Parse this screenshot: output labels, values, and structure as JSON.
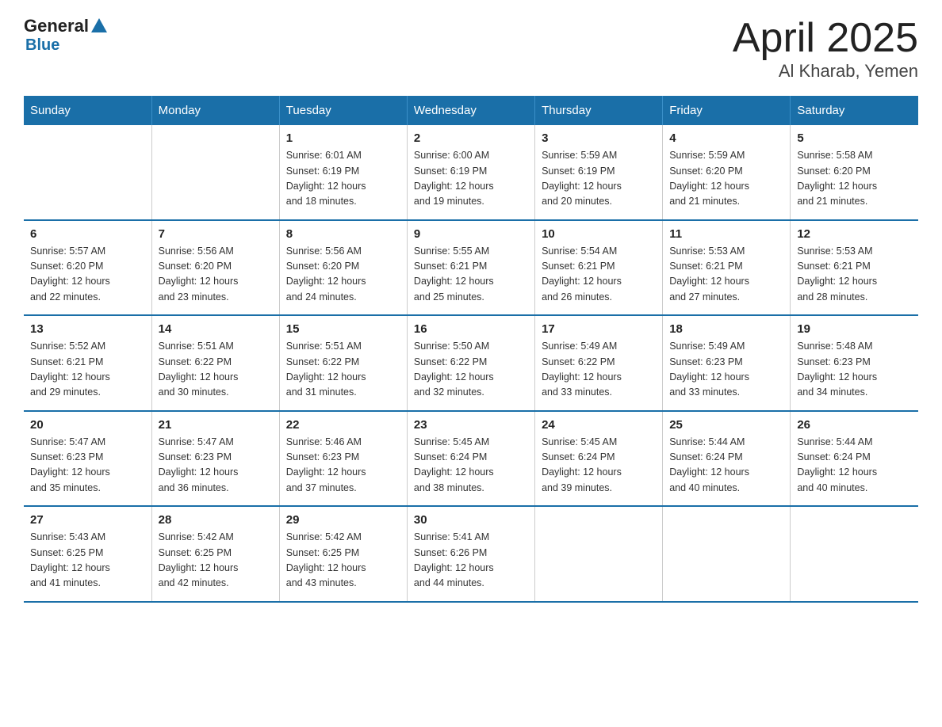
{
  "logo": {
    "general": "General",
    "blue": "Blue"
  },
  "title": "April 2025",
  "subtitle": "Al Kharab, Yemen",
  "days_header": [
    "Sunday",
    "Monday",
    "Tuesday",
    "Wednesday",
    "Thursday",
    "Friday",
    "Saturday"
  ],
  "weeks": [
    [
      {
        "day": "",
        "info": ""
      },
      {
        "day": "",
        "info": ""
      },
      {
        "day": "1",
        "info": "Sunrise: 6:01 AM\nSunset: 6:19 PM\nDaylight: 12 hours\nand 18 minutes."
      },
      {
        "day": "2",
        "info": "Sunrise: 6:00 AM\nSunset: 6:19 PM\nDaylight: 12 hours\nand 19 minutes."
      },
      {
        "day": "3",
        "info": "Sunrise: 5:59 AM\nSunset: 6:19 PM\nDaylight: 12 hours\nand 20 minutes."
      },
      {
        "day": "4",
        "info": "Sunrise: 5:59 AM\nSunset: 6:20 PM\nDaylight: 12 hours\nand 21 minutes."
      },
      {
        "day": "5",
        "info": "Sunrise: 5:58 AM\nSunset: 6:20 PM\nDaylight: 12 hours\nand 21 minutes."
      }
    ],
    [
      {
        "day": "6",
        "info": "Sunrise: 5:57 AM\nSunset: 6:20 PM\nDaylight: 12 hours\nand 22 minutes."
      },
      {
        "day": "7",
        "info": "Sunrise: 5:56 AM\nSunset: 6:20 PM\nDaylight: 12 hours\nand 23 minutes."
      },
      {
        "day": "8",
        "info": "Sunrise: 5:56 AM\nSunset: 6:20 PM\nDaylight: 12 hours\nand 24 minutes."
      },
      {
        "day": "9",
        "info": "Sunrise: 5:55 AM\nSunset: 6:21 PM\nDaylight: 12 hours\nand 25 minutes."
      },
      {
        "day": "10",
        "info": "Sunrise: 5:54 AM\nSunset: 6:21 PM\nDaylight: 12 hours\nand 26 minutes."
      },
      {
        "day": "11",
        "info": "Sunrise: 5:53 AM\nSunset: 6:21 PM\nDaylight: 12 hours\nand 27 minutes."
      },
      {
        "day": "12",
        "info": "Sunrise: 5:53 AM\nSunset: 6:21 PM\nDaylight: 12 hours\nand 28 minutes."
      }
    ],
    [
      {
        "day": "13",
        "info": "Sunrise: 5:52 AM\nSunset: 6:21 PM\nDaylight: 12 hours\nand 29 minutes."
      },
      {
        "day": "14",
        "info": "Sunrise: 5:51 AM\nSunset: 6:22 PM\nDaylight: 12 hours\nand 30 minutes."
      },
      {
        "day": "15",
        "info": "Sunrise: 5:51 AM\nSunset: 6:22 PM\nDaylight: 12 hours\nand 31 minutes."
      },
      {
        "day": "16",
        "info": "Sunrise: 5:50 AM\nSunset: 6:22 PM\nDaylight: 12 hours\nand 32 minutes."
      },
      {
        "day": "17",
        "info": "Sunrise: 5:49 AM\nSunset: 6:22 PM\nDaylight: 12 hours\nand 33 minutes."
      },
      {
        "day": "18",
        "info": "Sunrise: 5:49 AM\nSunset: 6:23 PM\nDaylight: 12 hours\nand 33 minutes."
      },
      {
        "day": "19",
        "info": "Sunrise: 5:48 AM\nSunset: 6:23 PM\nDaylight: 12 hours\nand 34 minutes."
      }
    ],
    [
      {
        "day": "20",
        "info": "Sunrise: 5:47 AM\nSunset: 6:23 PM\nDaylight: 12 hours\nand 35 minutes."
      },
      {
        "day": "21",
        "info": "Sunrise: 5:47 AM\nSunset: 6:23 PM\nDaylight: 12 hours\nand 36 minutes."
      },
      {
        "day": "22",
        "info": "Sunrise: 5:46 AM\nSunset: 6:23 PM\nDaylight: 12 hours\nand 37 minutes."
      },
      {
        "day": "23",
        "info": "Sunrise: 5:45 AM\nSunset: 6:24 PM\nDaylight: 12 hours\nand 38 minutes."
      },
      {
        "day": "24",
        "info": "Sunrise: 5:45 AM\nSunset: 6:24 PM\nDaylight: 12 hours\nand 39 minutes."
      },
      {
        "day": "25",
        "info": "Sunrise: 5:44 AM\nSunset: 6:24 PM\nDaylight: 12 hours\nand 40 minutes."
      },
      {
        "day": "26",
        "info": "Sunrise: 5:44 AM\nSunset: 6:24 PM\nDaylight: 12 hours\nand 40 minutes."
      }
    ],
    [
      {
        "day": "27",
        "info": "Sunrise: 5:43 AM\nSunset: 6:25 PM\nDaylight: 12 hours\nand 41 minutes."
      },
      {
        "day": "28",
        "info": "Sunrise: 5:42 AM\nSunset: 6:25 PM\nDaylight: 12 hours\nand 42 minutes."
      },
      {
        "day": "29",
        "info": "Sunrise: 5:42 AM\nSunset: 6:25 PM\nDaylight: 12 hours\nand 43 minutes."
      },
      {
        "day": "30",
        "info": "Sunrise: 5:41 AM\nSunset: 6:26 PM\nDaylight: 12 hours\nand 44 minutes."
      },
      {
        "day": "",
        "info": ""
      },
      {
        "day": "",
        "info": ""
      },
      {
        "day": "",
        "info": ""
      }
    ]
  ]
}
